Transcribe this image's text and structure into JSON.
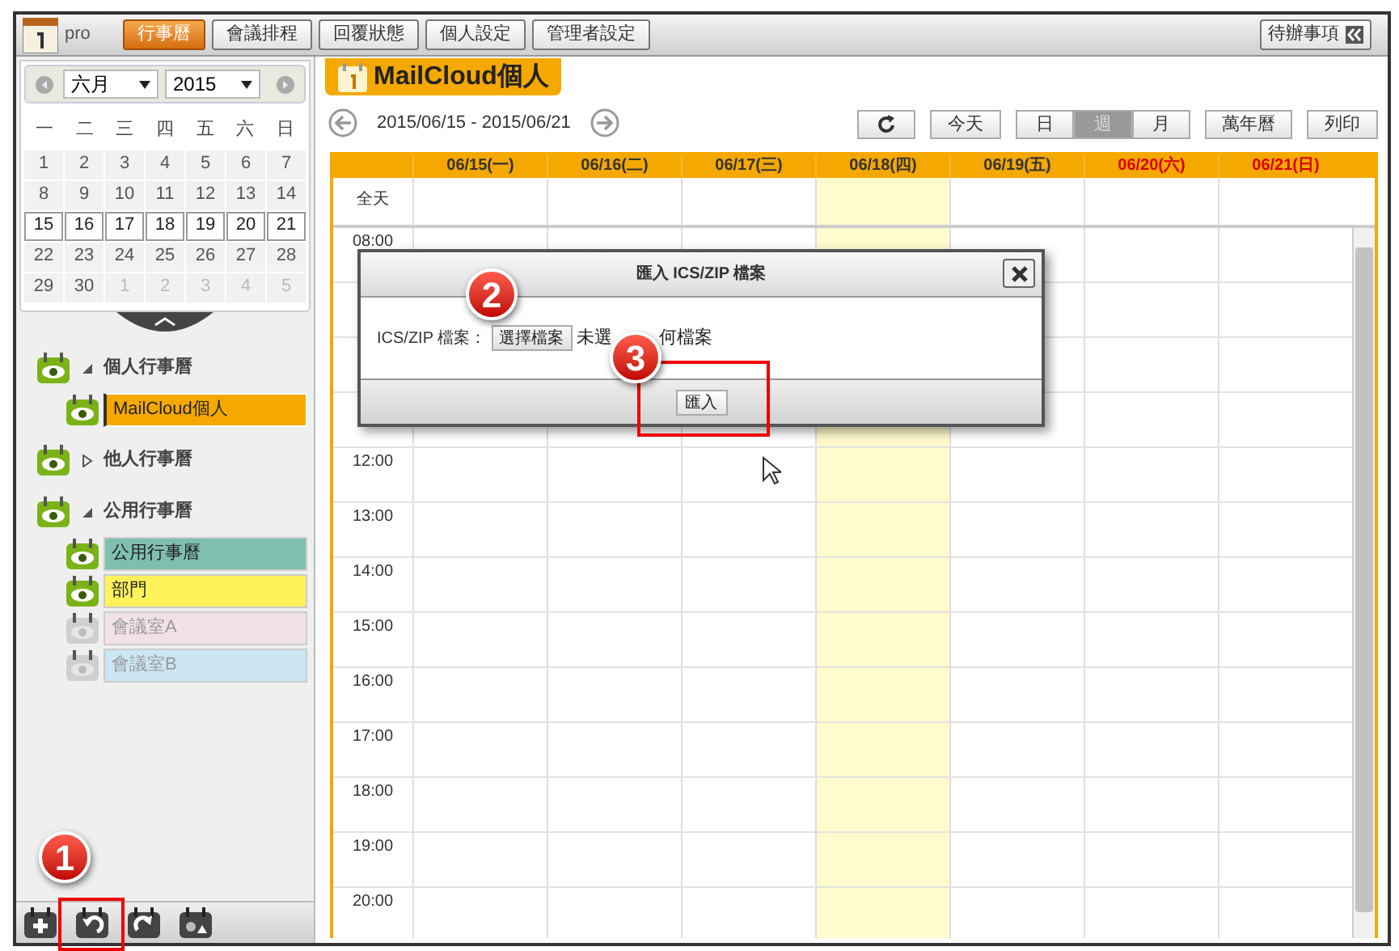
{
  "top_bar": {
    "logo_text": "pro",
    "tabs": [
      {
        "label": "行事曆",
        "selected": true
      },
      {
        "label": "會議排程",
        "selected": false
      },
      {
        "label": "回覆狀態",
        "selected": false
      },
      {
        "label": "個人設定",
        "selected": false
      },
      {
        "label": "管理者設定",
        "selected": false
      }
    ],
    "todo_button": "待辦事項"
  },
  "mini_calendar": {
    "month": "六月",
    "year": "2015",
    "weekdays": [
      "一",
      "二",
      "三",
      "四",
      "五",
      "六",
      "日"
    ],
    "weeks": [
      {
        "selected": false,
        "days": [
          {
            "d": "1",
            "muted": false
          },
          {
            "d": "2",
            "muted": false
          },
          {
            "d": "3",
            "muted": false
          },
          {
            "d": "4",
            "muted": false
          },
          {
            "d": "5",
            "muted": false
          },
          {
            "d": "6",
            "muted": false
          },
          {
            "d": "7",
            "muted": false
          }
        ]
      },
      {
        "selected": false,
        "days": [
          {
            "d": "8",
            "muted": false
          },
          {
            "d": "9",
            "muted": false
          },
          {
            "d": "10",
            "muted": false
          },
          {
            "d": "11",
            "muted": false
          },
          {
            "d": "12",
            "muted": false
          },
          {
            "d": "13",
            "muted": false
          },
          {
            "d": "14",
            "muted": false
          }
        ]
      },
      {
        "selected": true,
        "days": [
          {
            "d": "15",
            "muted": false
          },
          {
            "d": "16",
            "muted": false
          },
          {
            "d": "17",
            "muted": false
          },
          {
            "d": "18",
            "muted": false
          },
          {
            "d": "19",
            "muted": false
          },
          {
            "d": "20",
            "muted": false
          },
          {
            "d": "21",
            "muted": false
          }
        ]
      },
      {
        "selected": false,
        "days": [
          {
            "d": "22",
            "muted": false
          },
          {
            "d": "23",
            "muted": false
          },
          {
            "d": "24",
            "muted": false
          },
          {
            "d": "25",
            "muted": false
          },
          {
            "d": "26",
            "muted": false
          },
          {
            "d": "27",
            "muted": false
          },
          {
            "d": "28",
            "muted": false
          }
        ]
      },
      {
        "selected": false,
        "days": [
          {
            "d": "29",
            "muted": false
          },
          {
            "d": "30",
            "muted": false
          },
          {
            "d": "1",
            "muted": true
          },
          {
            "d": "2",
            "muted": true
          },
          {
            "d": "3",
            "muted": true
          },
          {
            "d": "4",
            "muted": true
          },
          {
            "d": "5",
            "muted": true
          }
        ]
      }
    ]
  },
  "calendar_list": [
    {
      "label": "個人行事曆",
      "expanded": true,
      "children": [
        {
          "label": "MailCloud個人",
          "color": "#f5a800",
          "selected": true,
          "enabled": true
        }
      ]
    },
    {
      "label": "他人行事曆",
      "expanded": false
    },
    {
      "label": "公用行事曆",
      "expanded": true,
      "children": [
        {
          "label": "公用行事曆",
          "color": "#7fbfae",
          "selected": false,
          "enabled": true
        },
        {
          "label": "部門",
          "color": "#fff25a",
          "selected": false,
          "enabled": true
        },
        {
          "label": "會議室A",
          "color": "#f3e1ea",
          "selected": false,
          "enabled": false
        },
        {
          "label": "會議室B",
          "color": "#cce6f4",
          "selected": false,
          "enabled": false
        }
      ]
    }
  ],
  "main": {
    "title": "MailCloud個人",
    "date_range": "2015/06/15 - 2015/06/21",
    "today_button": "今天",
    "views": [
      {
        "label": "日",
        "selected": false
      },
      {
        "label": "週",
        "selected": true
      },
      {
        "label": "月",
        "selected": false
      }
    ],
    "perpetual_button": "萬年曆",
    "print_button": "列印",
    "days": [
      {
        "label": "06/15(一)",
        "today": false,
        "weekend": false
      },
      {
        "label": "06/16(二)",
        "today": false,
        "weekend": false
      },
      {
        "label": "06/17(三)",
        "today": false,
        "weekend": false
      },
      {
        "label": "06/18(四)",
        "today": true,
        "weekend": false
      },
      {
        "label": "06/19(五)",
        "today": false,
        "weekend": false
      },
      {
        "label": "06/20(六)",
        "today": false,
        "weekend": true
      },
      {
        "label": "06/21(日)",
        "today": false,
        "weekend": true
      }
    ],
    "all_day_label": "全天",
    "time_rows": [
      {
        "time": "08:00"
      },
      {},
      {},
      {},
      {
        "time": "12:00"
      },
      {
        "time": "13:00"
      },
      {
        "time": "14:00"
      },
      {
        "time": "15:00"
      },
      {
        "time": "16:00"
      },
      {
        "time": "17:00"
      },
      {
        "time": "18:00"
      },
      {
        "time": "19:00"
      },
      {
        "time": "20:00"
      }
    ]
  },
  "dialog": {
    "title": "匯入 ICS/ZIP 檔案",
    "field_label": "ICS/ZIP 檔案：",
    "choose_button": "選擇檔案",
    "file_status_parts": [
      "未選",
      "何檔案"
    ],
    "submit_button": "匯入"
  },
  "annotations": [
    {
      "label": "1"
    },
    {
      "label": "2"
    },
    {
      "label": "3"
    }
  ]
}
